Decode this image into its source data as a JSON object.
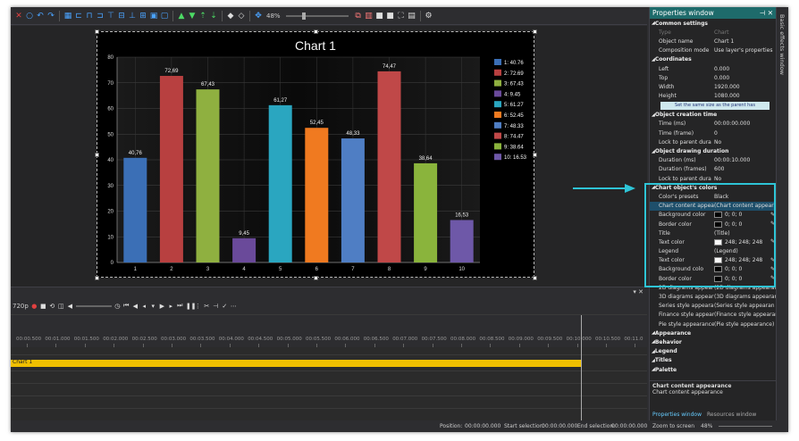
{
  "toolbar": {
    "zoom": "48%"
  },
  "chart_data": {
    "type": "bar",
    "title": "Chart 1",
    "categories": [
      "1",
      "2",
      "3",
      "4",
      "5",
      "6",
      "7",
      "8",
      "9",
      "10"
    ],
    "values": [
      40.76,
      72.69,
      67.43,
      9.45,
      61.27,
      52.45,
      48.33,
      74.47,
      38.64,
      16.53
    ],
    "value_labels": [
      "40,76",
      "72,69",
      "67,43",
      "9,45",
      "61,27",
      "52,45",
      "48,33",
      "74,47",
      "38,64",
      "16,53"
    ],
    "legend": [
      "1: 40.76",
      "2: 72.69",
      "3: 67.43",
      "4: 9.45",
      "5: 61.27",
      "6: 52.45",
      "7: 48.33",
      "8: 74.47",
      "9: 38.64",
      "10: 16.53"
    ],
    "colors": [
      "#3b6fb6",
      "#b84040",
      "#8fb040",
      "#6a4a9a",
      "#2aa6c0",
      "#f07a20",
      "#4f7ec4",
      "#c04848",
      "#8ab43c",
      "#6e58a8"
    ],
    "ylim": [
      0,
      80
    ],
    "yticks": [
      "0",
      "10",
      "20",
      "30",
      "40",
      "50",
      "60",
      "70",
      "80"
    ],
    "legend_position": "right",
    "grid": true
  },
  "timeline": {
    "resolution": "720p",
    "track_label": "Chart 1",
    "ticks": [
      "00:00.500",
      "00:01.000",
      "00:01.500",
      "00:02.000",
      "00:02.500",
      "00:03.000",
      "00:03.500",
      "00:04.000",
      "00:04.500",
      "00:05.000",
      "00:05.500",
      "00:06.000",
      "00:06.500",
      "00:07.000",
      "00:07.500",
      "00:08.000",
      "00:08.500",
      "00:09.000",
      "00:09.500",
      "00:10.000",
      "00:10.500",
      "00:11.0"
    ]
  },
  "status": {
    "position_label": "Position:",
    "position": "00:00:00.000",
    "start_sel_label": "Start selection:",
    "start_sel": "00:00:00.000",
    "end_sel_label": "End selection:",
    "end_sel": "00:00:00.000",
    "zoom_label": "Zoom to screen",
    "zoom": "48%"
  },
  "properties": {
    "title": "Properties window",
    "side_tab": "Basic effects window",
    "rows": [
      {
        "k": "Common settings",
        "type": "section"
      },
      {
        "k": "Type",
        "v": "Chart",
        "type": "grey"
      },
      {
        "k": "Object name",
        "v": "Chart 1"
      },
      {
        "k": "Composition mode",
        "v": "Use layer's properties"
      },
      {
        "k": "Coordinates",
        "type": "section"
      },
      {
        "k": "Left",
        "v": "0.000"
      },
      {
        "k": "Top",
        "v": "0.000"
      },
      {
        "k": "Width",
        "v": "1920.000"
      },
      {
        "k": "Height",
        "v": "1080.000"
      },
      {
        "k": "Set the same size as the parent has",
        "type": "button"
      },
      {
        "k": "Object creation time",
        "type": "section"
      },
      {
        "k": "Time (ms)",
        "v": "00:00:00.000"
      },
      {
        "k": "Time (frame)",
        "v": "0"
      },
      {
        "k": "Lock to parent dura",
        "v": "No"
      },
      {
        "k": "Object drawing duration",
        "type": "section"
      },
      {
        "k": "Duration (ms)",
        "v": "00:00:10.000"
      },
      {
        "k": "Duration (frames)",
        "v": "600"
      },
      {
        "k": "Lock to parent dura",
        "v": "No"
      },
      {
        "k": "Chart object's colors",
        "type": "section"
      },
      {
        "k": "Color's presets",
        "v": "Black"
      },
      {
        "k": "Chart content appear",
        "v": "(Chart content appearan",
        "type": "hl"
      },
      {
        "k": "Background color",
        "v": "0; 0; 0",
        "swatch": "#000000",
        "picker": true
      },
      {
        "k": "Border color",
        "v": "0; 0; 0",
        "swatch": "#000000",
        "picker": true
      },
      {
        "k": "Title",
        "v": "(Title)"
      },
      {
        "k": "Text color",
        "v": "248; 248; 248",
        "swatch": "#f8f8f8",
        "picker": true
      },
      {
        "k": "Legend",
        "v": "(Legend)"
      },
      {
        "k": "Text color",
        "v": "248; 248; 248",
        "swatch": "#f8f8f8",
        "picker": true
      },
      {
        "k": "Background colo",
        "v": "0; 0; 0",
        "swatch": "#000000",
        "picker": true
      },
      {
        "k": "Border color",
        "v": "0; 0; 0",
        "swatch": "#000000",
        "picker": true
      },
      {
        "k": "2D diagrams appear",
        "v": "(2D diagrams appearan"
      },
      {
        "k": "3D diagrams appear",
        "v": "(3D diagrams appearan"
      },
      {
        "k": "Series style appearan",
        "v": "(Series style appearan"
      },
      {
        "k": "Finance style appear",
        "v": "(Finance style appearan"
      },
      {
        "k": "Pie style appearance",
        "v": "(Pie style appearance)"
      },
      {
        "k": "Appearance",
        "type": "section"
      },
      {
        "k": "Behavior",
        "type": "section"
      },
      {
        "k": "Legend",
        "type": "section"
      },
      {
        "k": "Titles",
        "type": "section"
      },
      {
        "k": "Palette",
        "type": "section"
      }
    ],
    "desc_title": "Chart content appearance",
    "desc_text": "Chart content appearance",
    "tab_active": "Properties window",
    "tab_other": "Resources window"
  }
}
